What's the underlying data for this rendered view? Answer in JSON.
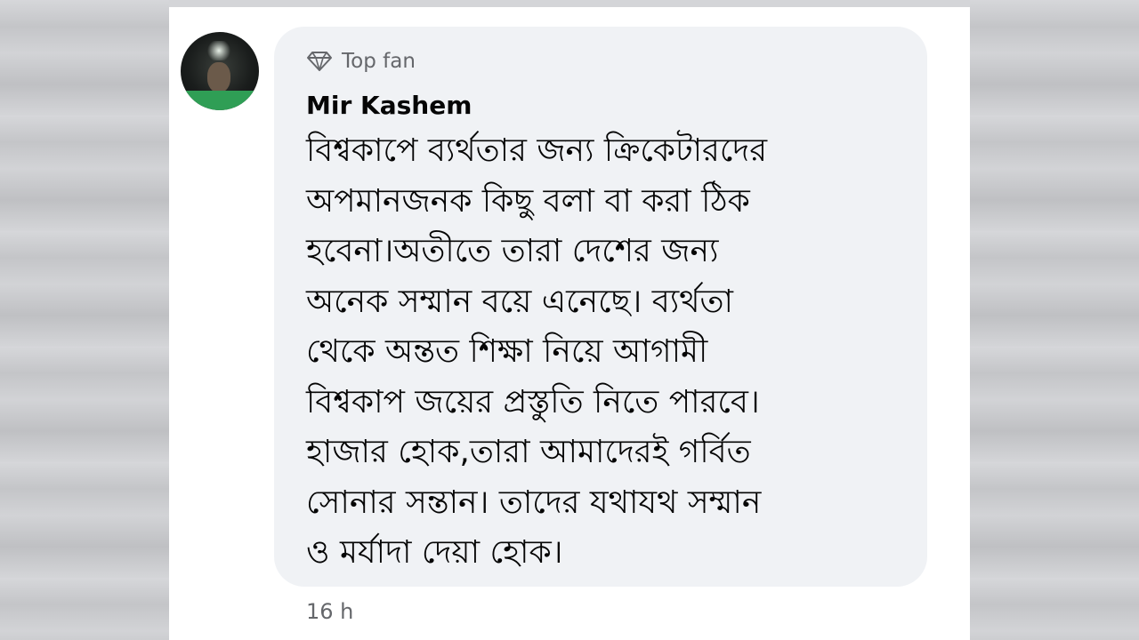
{
  "comment": {
    "badge": {
      "icon": "diamond-icon",
      "label": "Top fan"
    },
    "author": "Mir Kashem",
    "lines": [
      "বিশ্বকাপে ব্যর্থতার জন্য ক্রিকেটারদের",
      "অপমানজনক কিছু বলা বা করা ঠিক",
      "হবেনা।অতীতে তারা দেশের জন্য",
      "অনেক সম্মান বয়ে এনেছে। ব্যর্থতা",
      "থেকে অন্তত শিক্ষা নিয়ে আগামী",
      "বিশ্বকাপ জয়ের প্রস্তুতি নিতে পারবে।",
      "হাজার হোক,তারা আমাদেরই গর্বিত",
      "সোনার সন্তান। তাদের যথাযথ সম্মান",
      "ও মর্যাদা দেয়া হোক।"
    ],
    "timestamp": "16 h"
  },
  "colors": {
    "bubble": "#f0f2f5",
    "secondary_text": "#65676b",
    "primary_text": "#050505"
  }
}
